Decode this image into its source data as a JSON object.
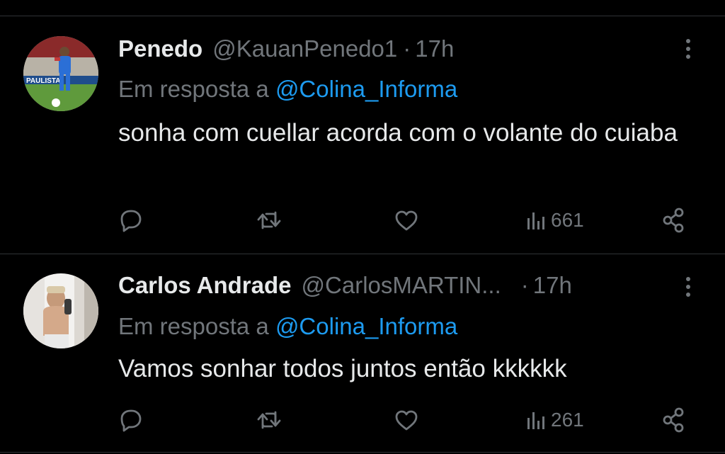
{
  "tweets": [
    {
      "display_name": "Penedo",
      "handle": "@KauanPenedo1",
      "separator": "·",
      "time": "17h",
      "reply_prefix": "Em resposta a",
      "reply_mention": "@Colina_Informa",
      "text": "sonha com cuellar acorda com o volante do cuiaba",
      "views": "661",
      "avatar_banner_text": "PAULISTA"
    },
    {
      "display_name": "Carlos Andrade",
      "handle": "@CarlosMARTIN...",
      "separator": "·",
      "time": "17h",
      "reply_prefix": "Em resposta a",
      "reply_mention": "@Colina_Informa",
      "text": "Vamos sonhar todos juntos então kkkkkk",
      "views": "261"
    }
  ],
  "icons": {
    "reply": "reply-icon",
    "retweet": "retweet-icon",
    "like": "like-icon",
    "views": "views-icon",
    "share": "share-icon",
    "more": "more-icon"
  },
  "colors": {
    "background": "#000000",
    "primary_text": "#e7e9ea",
    "secondary_text": "#71767b",
    "link": "#1d9bf0",
    "divider": "#2f3336"
  }
}
